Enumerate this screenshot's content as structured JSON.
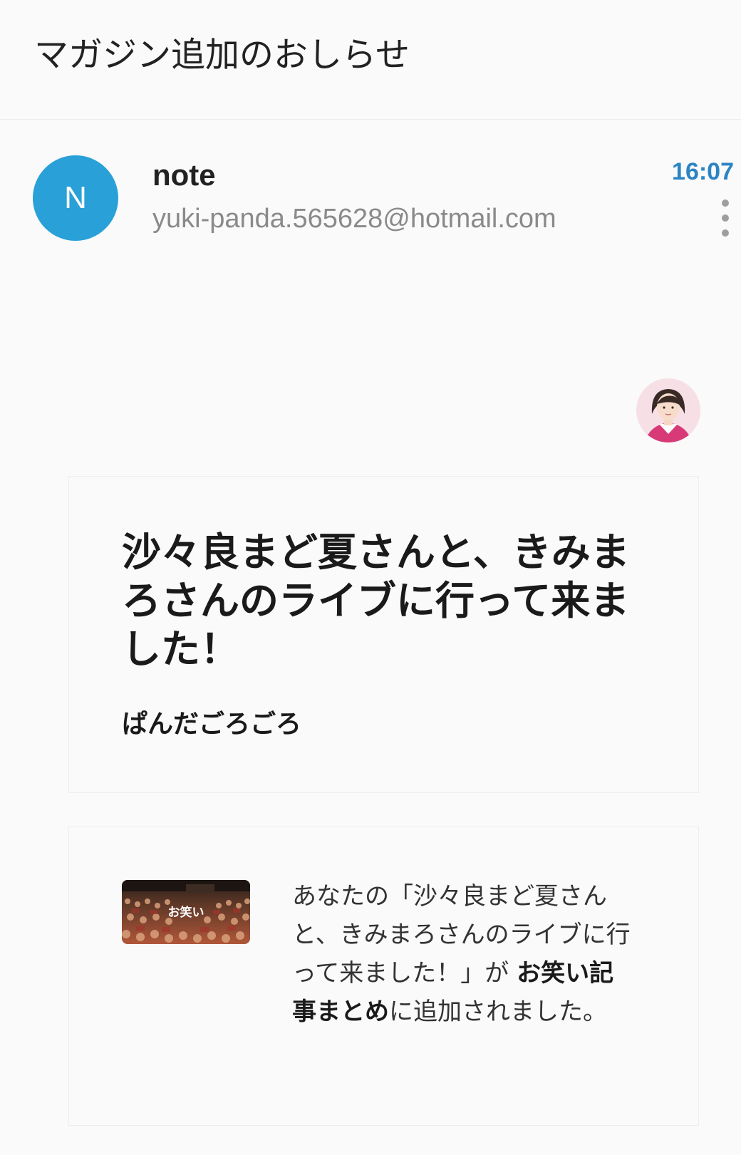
{
  "subject": "マガジン追加のおしらせ",
  "sender": {
    "avatar_letter": "N",
    "name": "note",
    "email": "yuki-panda.565628@hotmail.com",
    "time": "16:07"
  },
  "article": {
    "title": "沙々良まど夏さんと、きみまろさんのライブに行って来ました！",
    "author": "ぱんだごろごろ"
  },
  "notice": {
    "thumb_label": "お笑い",
    "part1": "あなたの「沙々良まど夏さんと、きみまろさんのライブに行って来ました！」が ",
    "magazine": "お笑い記事まとめ",
    "part2": "に追加されました。"
  },
  "colors": {
    "avatar_bg": "#29a0d8",
    "time": "#2b84c4"
  },
  "icons": {
    "more": "more-vertical-icon",
    "profile": "profile-avatar-icon"
  }
}
